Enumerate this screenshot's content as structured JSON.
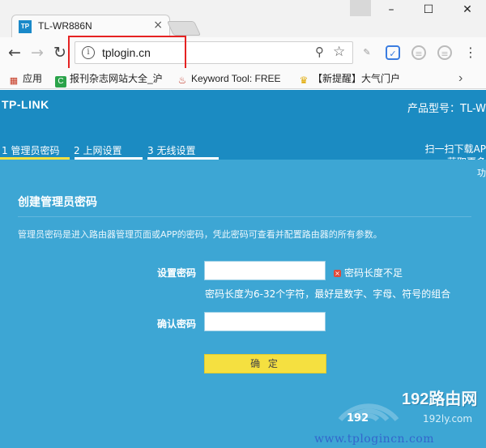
{
  "browser": {
    "tab_title": "TL-WR886N",
    "favicon_text": "TP",
    "tab_close": "×",
    "window_controls": {
      "minimize": "–",
      "maximize": "☐",
      "close": "✕"
    },
    "url": "tplogin.cn",
    "info_glyph": "i",
    "bookmarks": [
      {
        "label": "应用",
        "icon": "apps-grid-icon"
      },
      {
        "label": "报刊杂志网站大全_沪",
        "icon": "green-c-icon"
      },
      {
        "label": "Keyword Tool: FREE",
        "icon": "flame-icon"
      },
      {
        "label": "【新提醒】大气门户",
        "icon": "trophy-icon"
      }
    ],
    "more_glyph": "›"
  },
  "router": {
    "logo": "TP-LINK",
    "model_label": "产品型号：TL-W",
    "steps": [
      {
        "label": "1 管理员密码"
      },
      {
        "label": "2 上网设置"
      },
      {
        "label": "3 无线设置"
      }
    ],
    "qr_lines": [
      "扫一扫下载AP",
      "获取更多",
      "功"
    ],
    "panel": {
      "title": "创建管理员密码",
      "description": "管理员密码是进入路由器管理页面或APP的密码，凭此密码可查看并配置路由器的所有参数。",
      "set_password_label": "设置密码",
      "set_password_value": "",
      "error_text": "密码长度不足",
      "error_glyph": "×",
      "hint": "密码长度为6-32个字符，最好是数字、字母、符号的组合",
      "confirm_password_label": "确认密码",
      "confirm_password_value": "",
      "confirm_button": "确 定"
    }
  },
  "watermark": {
    "brand": "192路由网",
    "sub_left": "192",
    "sub_right": "192ly.com",
    "url": "www.tplogincn.com"
  },
  "colors": {
    "header_blue": "#1b8bc2",
    "panel_blue": "#3da6d4",
    "button_yellow": "#f5e040",
    "error_red": "#e04a3a",
    "highlight_red": "#e52222"
  }
}
